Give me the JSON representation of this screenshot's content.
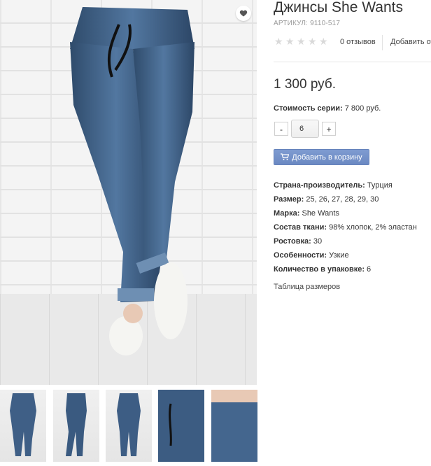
{
  "product": {
    "title": "Джинсы She Wants",
    "sku": "АРТИКУЛ: 9110-517",
    "rating_stars": 5,
    "reviews": "0 отзывов",
    "add_review": "Добавить от",
    "price": "1 300 руб.",
    "series_label": "Стоимость серии:",
    "series_value": " 7 800 руб.",
    "qty_minus": "-",
    "qty_value": "6",
    "qty_plus": "+",
    "cart_button": "Добавить в корзину"
  },
  "specs": [
    {
      "label": "Страна-производитель:",
      "value": " Турция"
    },
    {
      "label": "Размер:",
      "value": " 25, 26, 27, 28, 29, 30"
    },
    {
      "label": "Марка:",
      "value": " She Wants"
    },
    {
      "label": "Состав ткани:",
      "value": " 98% хлопок, 2% эластан"
    },
    {
      "label": "Ростовка:",
      "value": " 30"
    },
    {
      "label": "Особенности:",
      "value": " Узкие"
    },
    {
      "label": "Количество в упаковке:",
      "value": " 6"
    }
  ],
  "size_table_link": "Таблица размеров",
  "colors": {
    "accent": "#6b89c2",
    "denim": "#3d5b7d",
    "star_empty": "#d9d9d9"
  },
  "icons": {
    "wishlist": "heart-icon",
    "cart": "cart-icon",
    "rating": "star-icon"
  }
}
